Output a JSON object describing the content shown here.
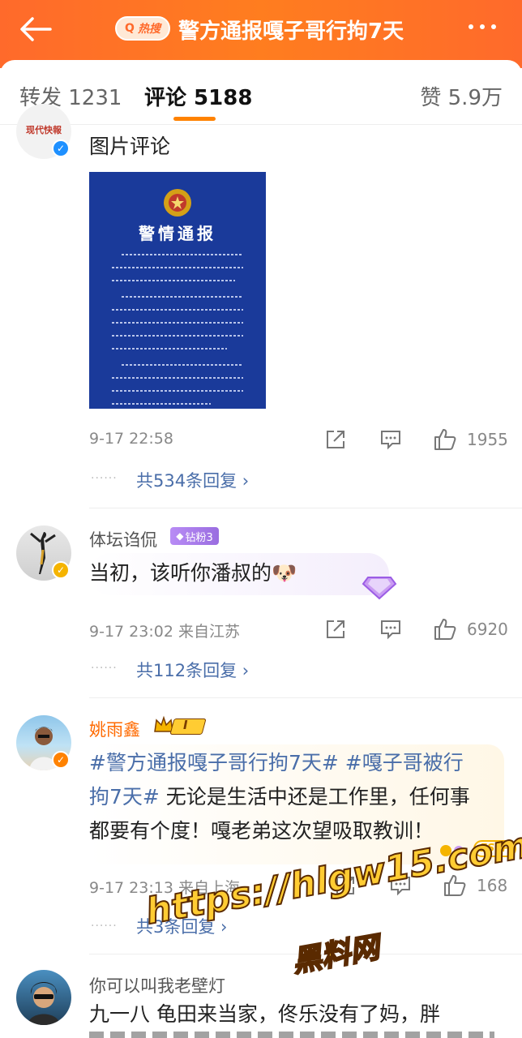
{
  "header": {
    "hot_label": "热搜",
    "title": "警方通报嘎子哥行拘7天"
  },
  "tabs": {
    "repost": "转发 1231",
    "comment": "评论 5188",
    "like": "赞 5.9万"
  },
  "comments": [
    {
      "avatar_text": "现代快報",
      "text": "图片评论",
      "image": {
        "title": "警情通报"
      },
      "time": "9-17 22:58",
      "likes": "1955",
      "replies": "共534条回复 ›"
    },
    {
      "name": "体坛诌侃",
      "badge": "钻粉3",
      "text": "当初，该听你潘叔的🐶",
      "time": "9-17 23:02  来自江苏",
      "likes": "6920",
      "replies": "共112条回复 ›"
    },
    {
      "name": "姚雨鑫",
      "badge": "I",
      "hashtag1": "#警方通报嘎子哥行拘7天#",
      "hashtag2a": "#嘎子哥被行",
      "hashtag2b": "拘7天#",
      "text_rest1": " 无论是生活中还是工作里，任何事",
      "text_rest2": "都要有个度！嘎老弟这次望吸取教训！",
      "sticker": "ESTP",
      "time": "9-17 23:13  来自上海",
      "likes": "168",
      "replies": "共3条回复 ›"
    },
    {
      "name": "你可以叫我老壁灯",
      "text": "九一八 龟田来当家，佟乐没有了妈，胖"
    }
  ],
  "watermark": {
    "url": "https://hlgw15.com",
    "brand": "黑料网"
  },
  "colors": {
    "header": "#ff7d1f",
    "accent": "#ff8200",
    "link": "#4a6ea9"
  }
}
